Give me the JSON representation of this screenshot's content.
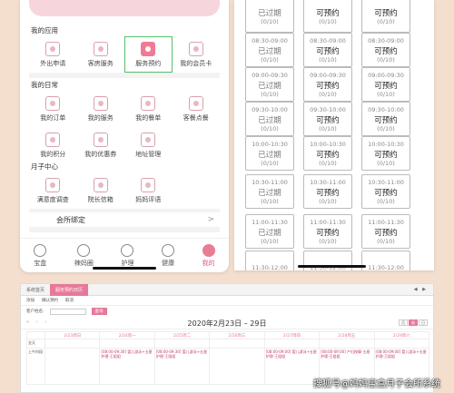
{
  "app": {
    "sections": [
      {
        "title": "我的应用",
        "items": [
          {
            "label": "外出申请",
            "icon": "outing-request-icon"
          },
          {
            "label": "客房服务",
            "icon": "bed-icon"
          },
          {
            "label": "服务预约",
            "icon": "appointment-icon",
            "selected": true
          },
          {
            "label": "我的会员卡",
            "icon": "member-card-icon"
          }
        ]
      },
      {
        "title": "我的日常",
        "items": [
          {
            "label": "我的订单",
            "icon": "order-icon"
          },
          {
            "label": "我的服务",
            "icon": "service-icon"
          },
          {
            "label": "我的餐单",
            "icon": "meal-icon"
          },
          {
            "label": "客餐点餐",
            "icon": "order-meal-icon"
          },
          {
            "label": "我的积分",
            "icon": "points-icon"
          },
          {
            "label": "我的优惠券",
            "icon": "coupon-icon"
          },
          {
            "label": "地址管理",
            "icon": "location-icon"
          }
        ]
      },
      {
        "title": "月子中心",
        "items": [
          {
            "label": "满意度调查",
            "icon": "survey-icon"
          },
          {
            "label": "院长信箱",
            "icon": "mailbox-icon"
          },
          {
            "label": "妈妈评语",
            "icon": "comment-icon"
          }
        ]
      }
    ],
    "club_binding": {
      "label": "会所绑定",
      "arrow": ">"
    },
    "tabs": [
      {
        "label": "宝盒",
        "icon": "treasure-box-icon"
      },
      {
        "label": "辣妈圈",
        "icon": "circle-icon"
      },
      {
        "label": "护理",
        "icon": "care-icon"
      },
      {
        "label": "健康",
        "icon": "health-icon"
      },
      {
        "label": "我的",
        "icon": "profile-icon",
        "active": true
      }
    ]
  },
  "booking": {
    "rows": [
      {
        "time": "",
        "cells": [
          {
            "status": "已过期",
            "count": "(0/10)"
          },
          {
            "status": "可预约",
            "count": "(0/10)"
          },
          {
            "status": "可预约",
            "count": "(0/10)"
          }
        ]
      },
      {
        "time": "08:30-09:00",
        "cells": [
          {
            "status": "已过期",
            "count": "(0/10)"
          },
          {
            "status": "可预约",
            "count": "(0/10)"
          },
          {
            "status": "可预约",
            "count": "(0/10)"
          }
        ]
      },
      {
        "time": "09:00-09:30",
        "cells": [
          {
            "status": "已过期",
            "count": "(0/10)"
          },
          {
            "status": "可预约",
            "count": "(0/10)"
          },
          {
            "status": "可预约",
            "count": "(0/10)"
          }
        ]
      },
      {
        "time": "09:30-10:00",
        "cells": [
          {
            "status": "已过期",
            "count": "(0/10)"
          },
          {
            "status": "可预约",
            "count": "(0/10)"
          },
          {
            "status": "可预约",
            "count": "(0/10)"
          }
        ]
      },
      {
        "time": "10:00-10:30",
        "cells": [
          {
            "status": "已过期",
            "count": "(0/10)"
          },
          {
            "status": "可预约",
            "count": "(0/10)"
          },
          {
            "status": "可预约",
            "count": "(0/10)"
          }
        ]
      },
      {
        "time": "10:30-11:00",
        "cells": [
          {
            "status": "已过期",
            "count": "(0/10)"
          },
          {
            "status": "可预约",
            "count": "(0/10)"
          },
          {
            "status": "可预约",
            "count": "(0/10)"
          }
        ]
      },
      {
        "time": "11:00-11:30",
        "cells": [
          {
            "status": "已过期",
            "count": "(0/10)"
          },
          {
            "status": "可预约",
            "count": "(0/10)"
          },
          {
            "status": "可预约",
            "count": "(0/10)"
          }
        ]
      },
      {
        "time": "11:30-12:00",
        "cells": [
          {
            "status": "",
            "count": ""
          },
          {
            "status": "",
            "count": ""
          },
          {
            "status": "",
            "count": ""
          }
        ]
      }
    ]
  },
  "desktop": {
    "tabs": [
      {
        "label": "系统首页"
      },
      {
        "label": "服务预约日历"
      }
    ],
    "toolbar": [
      "添加",
      "确认预约",
      "取消"
    ],
    "filter_label": "客户姓名:",
    "filter_button": "查询",
    "date_range": "2020年2月23日 – 29日",
    "nav_arrows": "« ‹ ›",
    "views": [
      "月",
      "周",
      "日"
    ],
    "columns": [
      "",
      "2/23周日",
      "2/24周一",
      "2/25周二",
      "2/26周三",
      "2/27周四",
      "2/28周五",
      "2/29周六"
    ],
    "rows": [
      {
        "label": "全天",
        "cells": [
          "",
          "",
          "",
          "",
          "",
          "",
          ""
        ]
      },
      {
        "label": "上午时段",
        "cells": [
          "",
          "[08:00-09:30] 婴儿游泳+五星护理-王姐姐",
          "[08:00-09:30] 婴儿游泳+五星护理-王姐姐",
          "",
          "[08:00-09:00] 婴儿游泳+五星护理-王姐姐",
          "[08:00-09:00] 产妇按摩-五星护理-王姐姐",
          "[08:00-09:00] 婴儿游泳+五星护理-王姐姐"
        ]
      }
    ]
  },
  "watermark": "搜狐号@妈妈宝盒月子会所系统",
  "colors": {
    "accent": "#e6799a",
    "selected_outline": "#55c06c",
    "background": "#f4dfcf"
  }
}
